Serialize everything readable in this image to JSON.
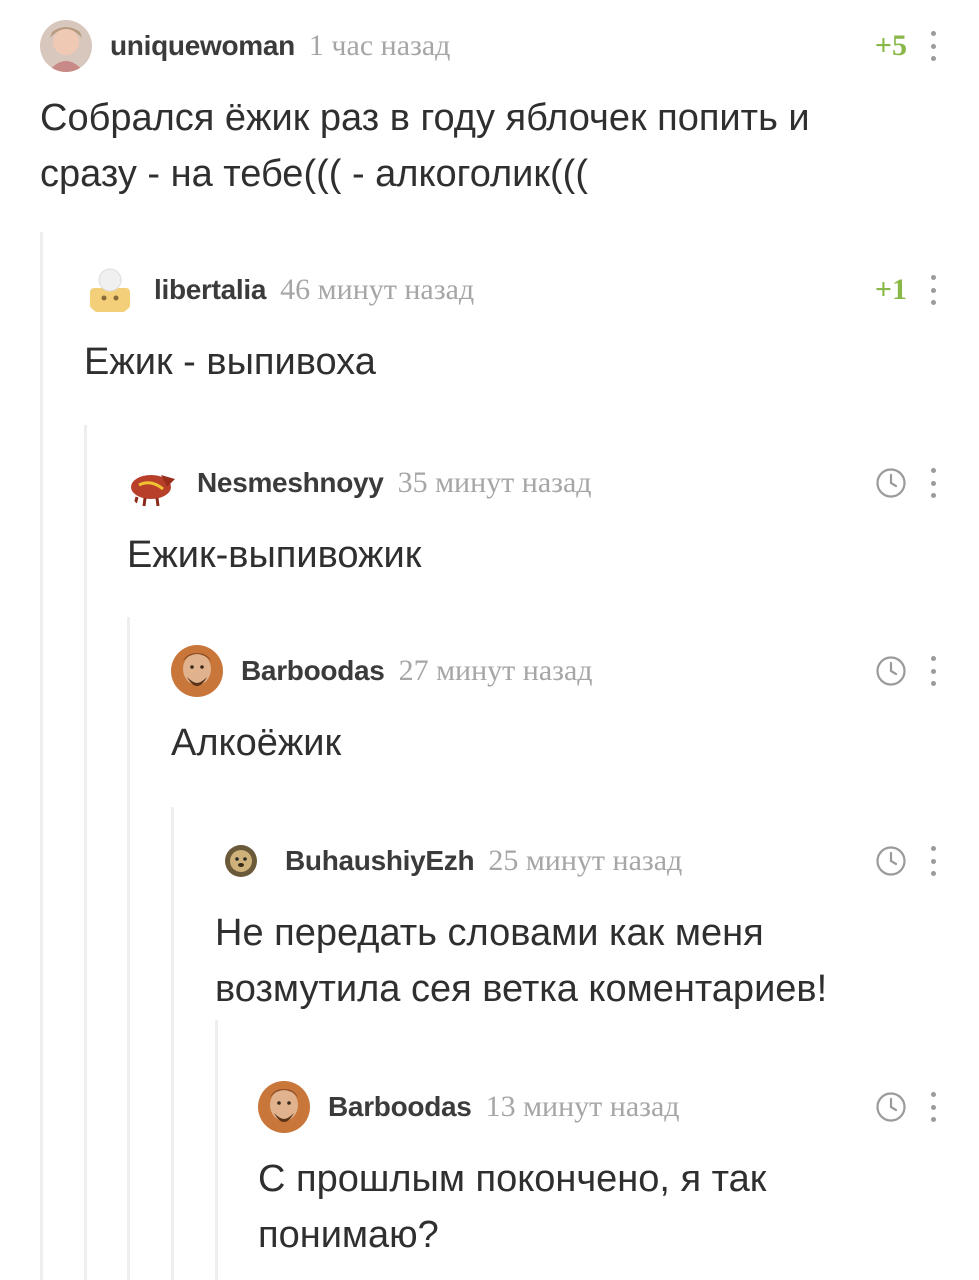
{
  "comments": [
    {
      "author": "uniquewoman",
      "time": "1 час назад",
      "rating": "+5",
      "text_lines": [
        "Собрался ёжик раз в году яблочек попить и",
        "сразу - на тебе((( - алкоголик((("
      ]
    },
    {
      "author": "libertalia",
      "time": "46 минут назад",
      "rating": "+1",
      "text_lines": [
        "Ежик - выпивоха"
      ]
    },
    {
      "author": "Nesmeshnoyy",
      "time": "35 минут назад",
      "rating": "",
      "text_lines": [
        "Ежик-выпивожик"
      ]
    },
    {
      "author": "Barboodas",
      "time": "27 минут назад",
      "rating": "",
      "text_lines": [
        "Алкоёжик"
      ]
    },
    {
      "author": "BuhaushiyEzh",
      "time": "25 минут назад",
      "rating": "",
      "text_lines": [
        "Не передать словами как меня",
        "возмутила сея ветка коментариев!"
      ]
    },
    {
      "author": "Barboodas",
      "time": "13 минут назад",
      "rating": "",
      "text_lines": [
        "С прошлым покончено, я так",
        "понимаю?"
      ]
    }
  ],
  "colors": {
    "rating": "#8ab848",
    "muted": "#a6a6a6",
    "line": "#eeeeee"
  },
  "icons": {
    "clock": "clock-icon",
    "more": "more-vertical-icon"
  }
}
